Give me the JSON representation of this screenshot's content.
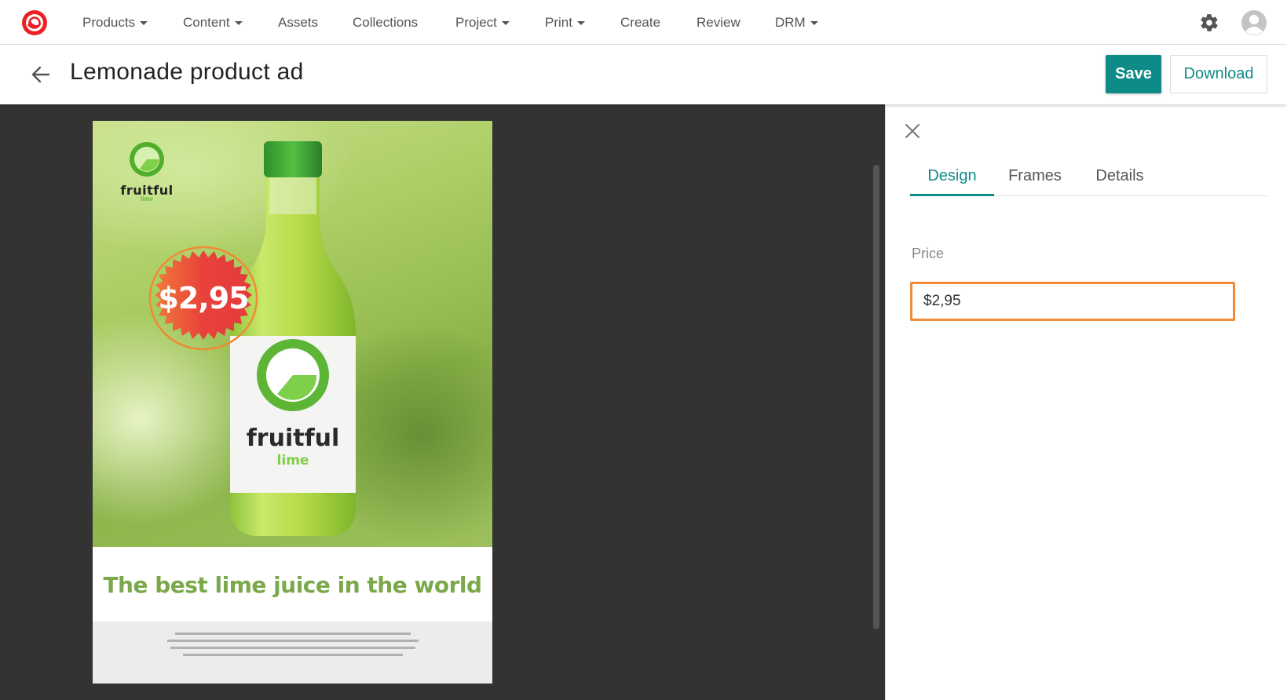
{
  "app": {
    "logo_icon": "sitecore-logo-icon",
    "brand_color": "#eb1f24"
  },
  "nav": {
    "items": [
      {
        "label": "Products",
        "dropdown": true
      },
      {
        "label": "Content",
        "dropdown": true
      },
      {
        "label": "Assets",
        "dropdown": false
      },
      {
        "label": "Collections",
        "dropdown": false
      },
      {
        "label": "Project",
        "dropdown": true
      },
      {
        "label": "Print",
        "dropdown": true
      },
      {
        "label": "Create",
        "dropdown": false
      },
      {
        "label": "Review",
        "dropdown": false
      },
      {
        "label": "DRM",
        "dropdown": true
      }
    ],
    "settings_icon": "gear-icon",
    "user_icon": "user-avatar-icon"
  },
  "header": {
    "title": "Lemonade product ad",
    "back_icon": "arrow-left-icon",
    "save_label": "Save",
    "download_label": "Download",
    "accent_color": "#0f8b87"
  },
  "poster": {
    "brand_name": "fruitful",
    "brand_sub": "lime",
    "bottle_brand": "fruitful",
    "bottle_sub": "lime",
    "price": "$2,95",
    "tagline": "The best lime juice in the world",
    "tagline_color": "#7aa84a",
    "badge_color": "#e8413b"
  },
  "panel": {
    "close_icon": "close-icon",
    "tabs": [
      {
        "label": "Design",
        "active": true
      },
      {
        "label": "Frames",
        "active": false
      },
      {
        "label": "Details",
        "active": false
      }
    ],
    "field_label": "Price",
    "field_value": "$2,95",
    "focus_color": "#f08a36"
  }
}
